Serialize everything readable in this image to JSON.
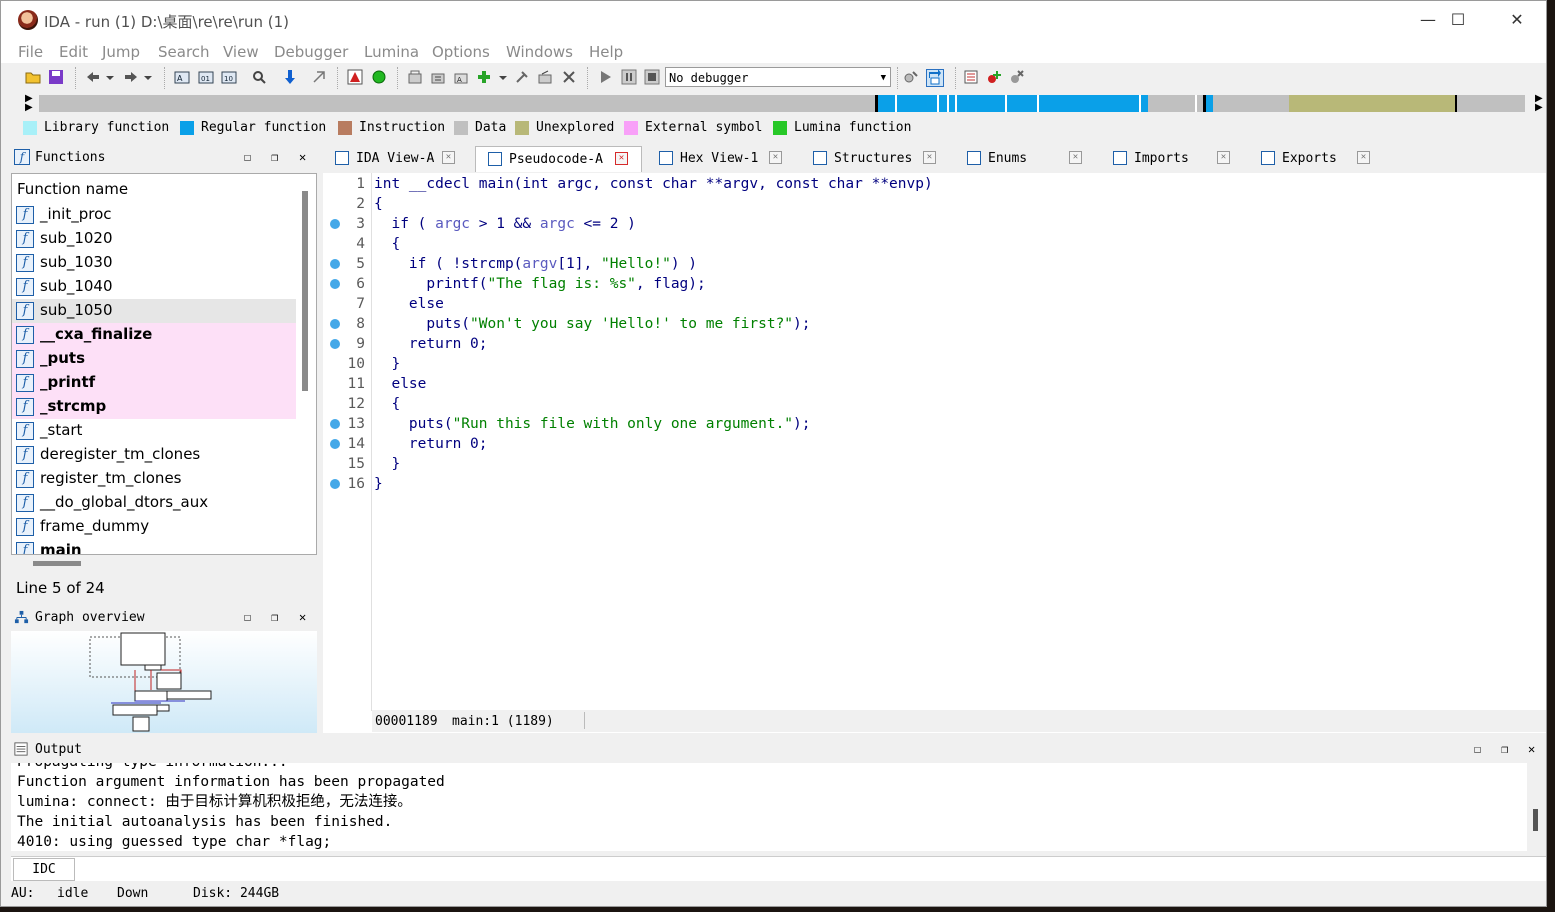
{
  "window": {
    "title": "IDA - run (1) D:\\桌面\\re\\re\\run (1)",
    "controls": [
      "—",
      "☐",
      "✕"
    ]
  },
  "menu": [
    "File",
    "Edit",
    "Jump",
    "Search",
    "View",
    "Debugger",
    "Lumina",
    "Options",
    "Windows",
    "Help"
  ],
  "toolbar": {
    "debugger_select": "No debugger"
  },
  "legend": [
    {
      "label": "Library function",
      "color": "#a8f0f8"
    },
    {
      "label": "Regular function",
      "color": "#0aa0e8"
    },
    {
      "label": "Instruction",
      "color": "#b87c60"
    },
    {
      "label": "Data",
      "color": "#c0c0c0"
    },
    {
      "label": "Unexplored",
      "color": "#b8b878"
    },
    {
      "label": "External symbol",
      "color": "#f8a0f8"
    },
    {
      "label": "Lumina function",
      "color": "#28c828"
    }
  ],
  "functions_panel": {
    "title": "Functions",
    "column_header": "Function name",
    "items": [
      {
        "name": "_init_proc",
        "kind": "regular"
      },
      {
        "name": "sub_1020",
        "kind": "regular"
      },
      {
        "name": "sub_1030",
        "kind": "regular"
      },
      {
        "name": "sub_1040",
        "kind": "regular"
      },
      {
        "name": "sub_1050",
        "kind": "selected"
      },
      {
        "name": "__cxa_finalize",
        "kind": "lib"
      },
      {
        "name": "_puts",
        "kind": "lib"
      },
      {
        "name": "_printf",
        "kind": "lib"
      },
      {
        "name": "_strcmp",
        "kind": "lib"
      },
      {
        "name": "_start",
        "kind": "regular"
      },
      {
        "name": "deregister_tm_clones",
        "kind": "regular"
      },
      {
        "name": "register_tm_clones",
        "kind": "regular"
      },
      {
        "name": "__do_global_dtors_aux",
        "kind": "regular"
      },
      {
        "name": "frame_dummy",
        "kind": "regular"
      },
      {
        "name": "main",
        "kind": "lib-bold"
      }
    ],
    "status": "Line 5 of 24"
  },
  "graph_panel": {
    "title": "Graph overview"
  },
  "tabs": [
    {
      "label": "IDA View-A",
      "active": false
    },
    {
      "label": "Pseudocode-A",
      "active": true
    },
    {
      "label": "Hex View-1",
      "active": false
    },
    {
      "label": "Structures",
      "active": false
    },
    {
      "label": "Enums",
      "active": false
    },
    {
      "label": "Imports",
      "active": false
    },
    {
      "label": "Exports",
      "active": false
    }
  ],
  "code": {
    "lines": [
      {
        "n": "1",
        "dot": false
      },
      {
        "n": "2",
        "dot": false
      },
      {
        "n": "3",
        "dot": true
      },
      {
        "n": "4",
        "dot": false
      },
      {
        "n": "5",
        "dot": true
      },
      {
        "n": "6",
        "dot": true
      },
      {
        "n": "7",
        "dot": false
      },
      {
        "n": "8",
        "dot": true
      },
      {
        "n": "9",
        "dot": true
      },
      {
        "n": "10",
        "dot": false
      },
      {
        "n": "11",
        "dot": false
      },
      {
        "n": "12",
        "dot": false
      },
      {
        "n": "13",
        "dot": true
      },
      {
        "n": "14",
        "dot": true
      },
      {
        "n": "15",
        "dot": false
      },
      {
        "n": "16",
        "dot": true
      }
    ],
    "text": [
      [
        {
          "t": "int __cdecl main(int argc, const char **argv, const char **envp)",
          "c": "kw"
        }
      ],
      [
        {
          "t": "{",
          "c": "plain"
        }
      ],
      [
        {
          "t": "  if ( ",
          "c": "plain"
        },
        {
          "t": "argc",
          "c": "arg"
        },
        {
          "t": " > 1 && ",
          "c": "plain"
        },
        {
          "t": "argc",
          "c": "arg"
        },
        {
          "t": " <= 2 )",
          "c": "plain"
        }
      ],
      [
        {
          "t": "  {",
          "c": "plain"
        }
      ],
      [
        {
          "t": "    if ( !strcmp(",
          "c": "plain"
        },
        {
          "t": "argv",
          "c": "arg"
        },
        {
          "t": "[1], ",
          "c": "plain"
        },
        {
          "t": "\"Hello!\"",
          "c": "str"
        },
        {
          "t": ") )",
          "c": "plain"
        }
      ],
      [
        {
          "t": "      printf(",
          "c": "plain"
        },
        {
          "t": "\"The flag is: %s\"",
          "c": "str"
        },
        {
          "t": ", flag);",
          "c": "plain"
        }
      ],
      [
        {
          "t": "    else",
          "c": "plain"
        }
      ],
      [
        {
          "t": "      puts(",
          "c": "plain"
        },
        {
          "t": "\"Won't you say 'Hello!' to me first?\"",
          "c": "str"
        },
        {
          "t": ");",
          "c": "plain"
        }
      ],
      [
        {
          "t": "    return 0;",
          "c": "plain"
        }
      ],
      [
        {
          "t": "  }",
          "c": "plain"
        }
      ],
      [
        {
          "t": "  else",
          "c": "plain"
        }
      ],
      [
        {
          "t": "  {",
          "c": "plain"
        }
      ],
      [
        {
          "t": "    puts(",
          "c": "plain"
        },
        {
          "t": "\"Run this file with only one argument.\"",
          "c": "str"
        },
        {
          "t": ");",
          "c": "plain"
        }
      ],
      [
        {
          "t": "    return 0;",
          "c": "plain"
        }
      ],
      [
        {
          "t": "  }",
          "c": "plain"
        }
      ],
      [
        {
          "t": "}",
          "c": "plain"
        }
      ]
    ],
    "status_addr": "00001189",
    "status_loc": "main:1 (1189)"
  },
  "output_panel": {
    "title": "Output",
    "lines": [
      "Propagating type information...",
      "Function argument information has been propagated",
      "lumina: connect: 由于目标计算机积极拒绝，无法连接。",
      "The initial autoanalysis has been finished.",
      "4010: using guessed type char *flag;"
    ],
    "cmd_button": "IDC"
  },
  "statusbar": {
    "au_label": "AU:",
    "au_value": "idle",
    "direction": "Down",
    "disk": "Disk: 244GB"
  }
}
